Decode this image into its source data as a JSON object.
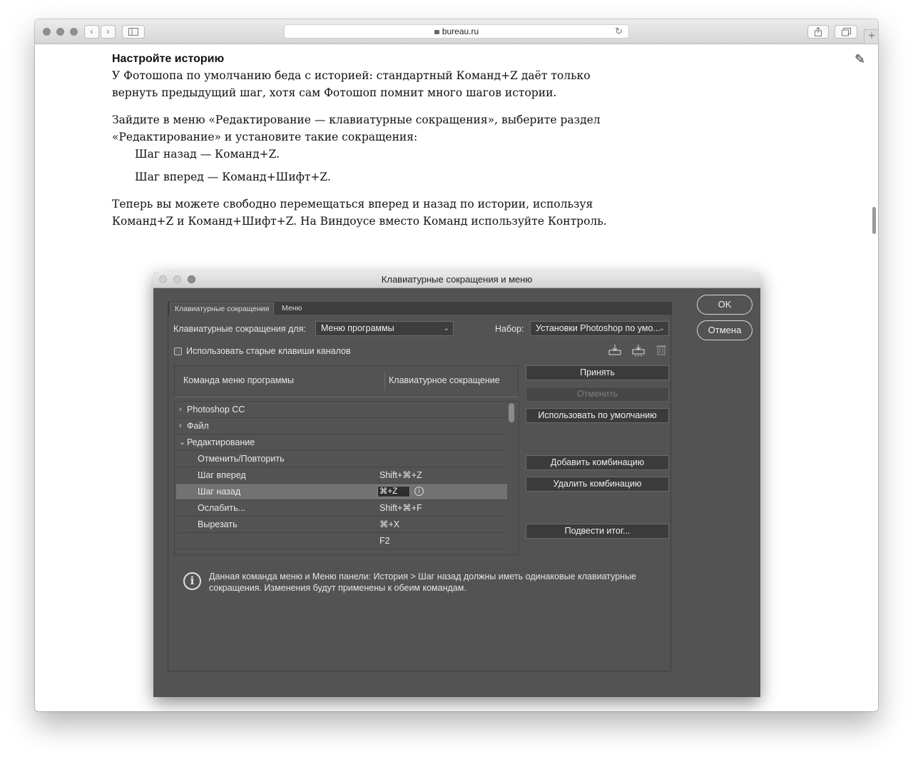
{
  "browser": {
    "url": "bureau.ru",
    "back_glyph": "‹",
    "forward_glyph": "›",
    "reload_glyph": "↻",
    "new_tab_glyph": "+",
    "edit_glyph": "✎"
  },
  "article": {
    "heading": "Настройте историю",
    "p1": "У Фотошопа по умолчанию беда с историей: стандартный Команд+Z даёт только вернуть предыдущий шаг, хотя сам Фотошоп помнит много шагов истории.",
    "p2": "Зайдите в меню «Редактирование — клавиатурные сокращения», выберите раздел «Редактирование» и установите такие сокращения:",
    "shortcut_back": "Шаг назад — Команд+Z.",
    "shortcut_forward": "Шаг вперед — Команд+Шифт+Z.",
    "p3": "Теперь вы можете свободно перемещаться вперед и назад по истории, используя Команд+Z и Команд+Шифт+Z. На Виндоусе вместо Команд используйте Контроль."
  },
  "dialog": {
    "title": "Клавиатурные сокращения и меню",
    "tabs": [
      "Клавиатурные сокращения",
      "Меню"
    ],
    "shortcuts_for_label": "Клавиатурные сокращения для:",
    "shortcuts_for_value": "Меню программы",
    "set_label": "Набор:",
    "set_value": "Установки Photoshop по умо...",
    "legacy_checkbox_label": "Использовать старые клавиши каналов",
    "col_command": "Команда меню программы",
    "col_shortcut": "Клавиатурное сокращение",
    "rows": [
      {
        "name": "Photoshop CC",
        "key": "",
        "arrow": "›"
      },
      {
        "name": "Файл",
        "key": "",
        "arrow": "›"
      },
      {
        "name": "Редактирование",
        "key": "",
        "arrow": "⌄"
      },
      {
        "name": "Отменить/Повторить",
        "key": ""
      },
      {
        "name": "Шаг вперед",
        "key": "Shift+⌘+Z"
      },
      {
        "name": "Шаг назад",
        "key": "⌘+Z"
      },
      {
        "name": "Ослабить...",
        "key": "Shift+⌘+F"
      },
      {
        "name": "Вырезать",
        "key": "⌘+X"
      },
      {
        "name": "",
        "key": "F2"
      }
    ],
    "buttons": {
      "accept": "Принять",
      "undo": "Отменить",
      "use_default": "Использовать по умолчанию",
      "add_shortcut": "Добавить комбинацию",
      "delete_shortcut": "Удалить комбинацию",
      "summarize": "Подвести итог...",
      "ok": "OK",
      "cancel": "Отмена"
    },
    "info_glyph": "i",
    "info_text": "Данная команда меню и Меню панели: История > Шаг назад должны иметь одинаковые клавиатурные сокращения.  Изменения будут применены к обеим командам."
  }
}
